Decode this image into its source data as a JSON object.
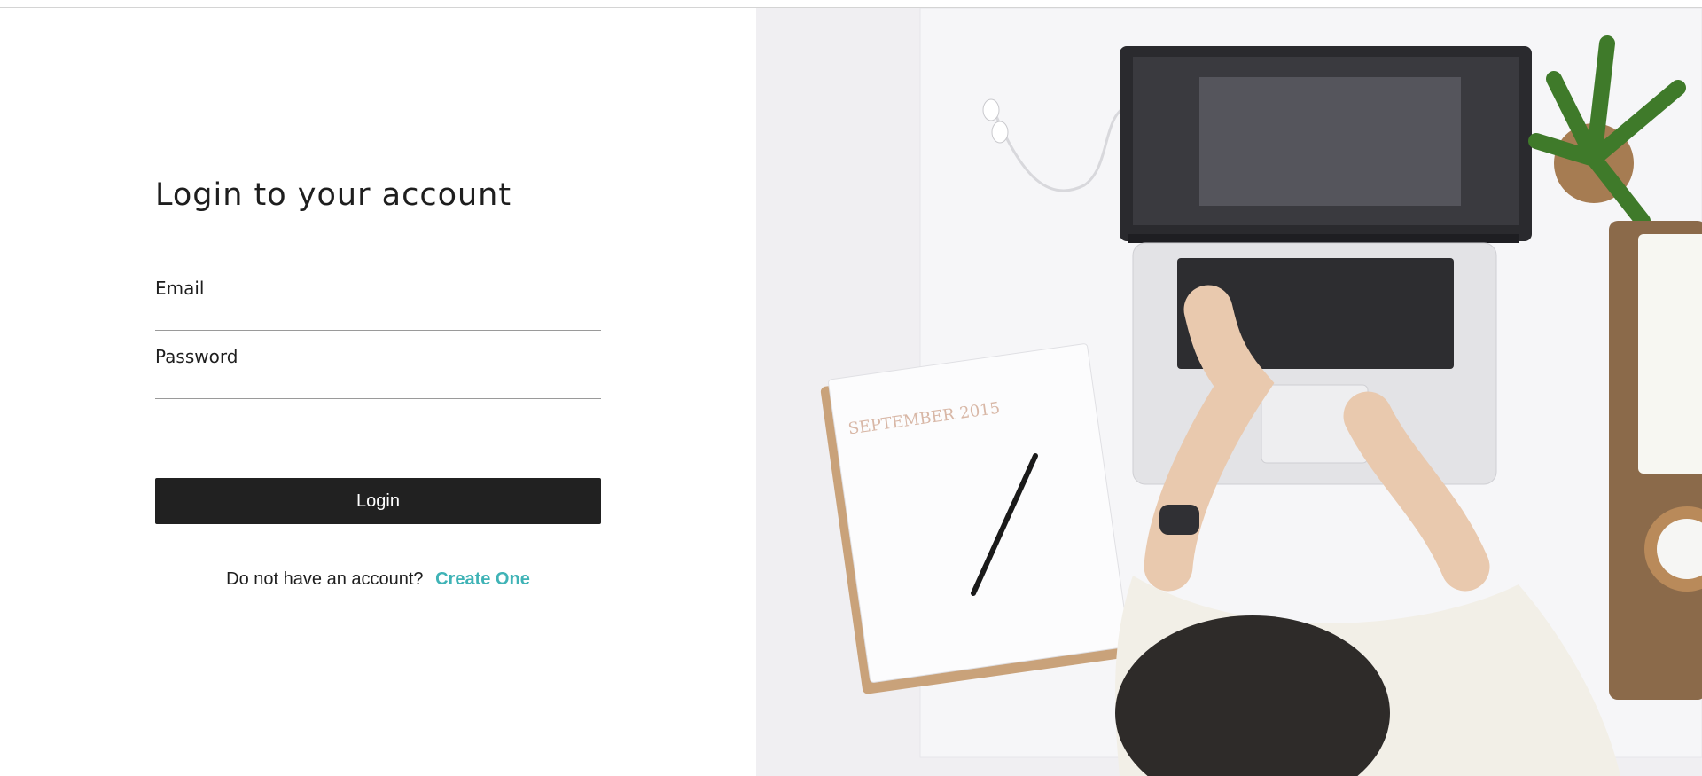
{
  "login": {
    "title": "Login to your account",
    "email_label": "Email",
    "email_value": "",
    "password_label": "Password",
    "password_value": "",
    "submit_label": "Login",
    "signup_prompt": "Do not have an account?",
    "signup_link": "Create One"
  },
  "hero": {
    "calendar_text": "SEPTEMBER 2015"
  },
  "colors": {
    "button_bg": "#212121",
    "link": "#3fb3b6",
    "text": "#1e1e1e"
  }
}
